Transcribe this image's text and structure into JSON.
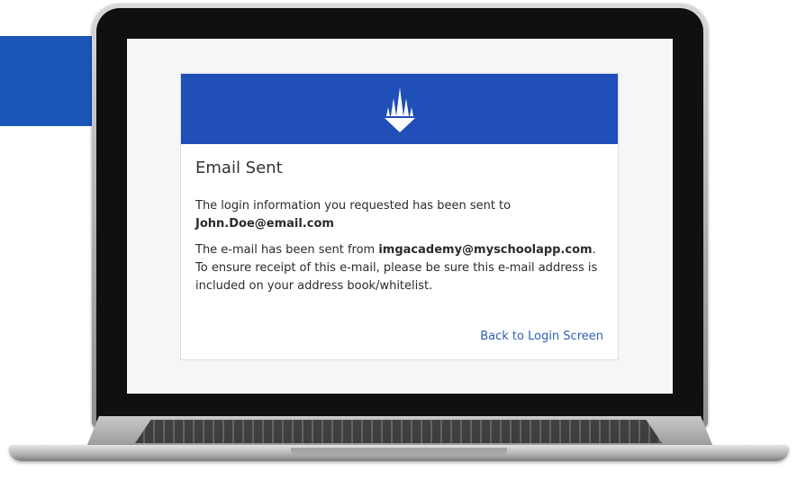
{
  "card": {
    "title": "Email Sent",
    "message": "The login information you requested has been sent to",
    "email": "John.Doe@email.com",
    "notice_prefix": "The e-mail has been sent from ",
    "sender_email": "imgacademy@myschoolapp.com",
    "notice_suffix": ". To ensure receipt of this e-mail, please be sure this e-mail address is included on your address book/whitelist.",
    "back_link": "Back to Login Screen"
  },
  "header": {
    "logo_icon": "crown-spikes-logo-icon",
    "color": "#1f4fb7"
  },
  "colors": {
    "link": "#2e5fb3",
    "accent_block": "#1a55b8"
  }
}
